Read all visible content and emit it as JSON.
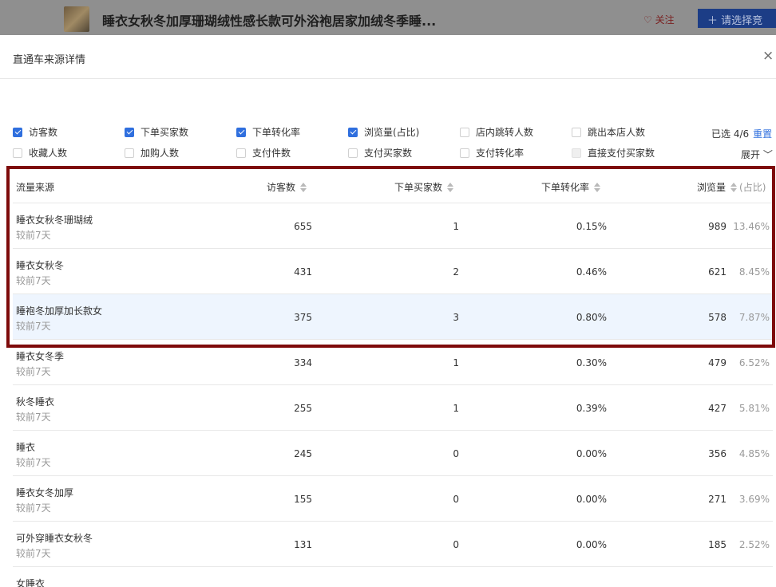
{
  "product": {
    "title": "睡衣女秋冬加厚珊瑚绒性感长款可外浴袍居家加绒冬季睡...",
    "follow_label": "关注",
    "select_button_label": "请选择竞"
  },
  "dialog": {
    "title": "直通车来源详情",
    "close_symbol": "×"
  },
  "filters": {
    "options": [
      {
        "label": "访客数",
        "checked": true
      },
      {
        "label": "下单买家数",
        "checked": true
      },
      {
        "label": "下单转化率",
        "checked": true
      },
      {
        "label": "浏览量(占比)",
        "checked": true
      },
      {
        "label": "店内跳转人数",
        "checked": false
      },
      {
        "label": "跳出本店人数",
        "checked": false
      },
      {
        "label": "收藏人数",
        "checked": false
      },
      {
        "label": "加购人数",
        "checked": false
      },
      {
        "label": "支付件数",
        "checked": false
      },
      {
        "label": "支付买家数",
        "checked": false
      },
      {
        "label": "支付转化率",
        "checked": false
      },
      {
        "label": "直接支付买家数",
        "checked": false,
        "disabled": true
      }
    ],
    "selected_text": "已选 4/6",
    "reset_label": "重置",
    "expand_label": "展开"
  },
  "table": {
    "headers": {
      "source": "流量来源",
      "visitors": "访客数",
      "buyers": "下单买家数",
      "conversion": "下单转化率",
      "views": "浏览量",
      "share": "(占比)"
    },
    "rows": [
      {
        "name": "睡衣女秋冬珊瑚绒",
        "sub": "较前7天",
        "visitors": "655",
        "buyers": "1",
        "conversion": "0.15%",
        "views": "989",
        "share": "13.46%"
      },
      {
        "name": "睡衣女秋冬",
        "sub": "较前7天",
        "visitors": "431",
        "buyers": "2",
        "conversion": "0.46%",
        "views": "621",
        "share": "8.45%"
      },
      {
        "name": "睡袍冬加厚加长款女",
        "sub": "较前7天",
        "visitors": "375",
        "buyers": "3",
        "conversion": "0.80%",
        "views": "578",
        "share": "7.87%"
      },
      {
        "name": "睡衣女冬季",
        "sub": "较前7天",
        "visitors": "334",
        "buyers": "1",
        "conversion": "0.30%",
        "views": "479",
        "share": "6.52%"
      },
      {
        "name": "秋冬睡衣",
        "sub": "较前7天",
        "visitors": "255",
        "buyers": "1",
        "conversion": "0.39%",
        "views": "427",
        "share": "5.81%"
      },
      {
        "name": "睡衣",
        "sub": "较前7天",
        "visitors": "245",
        "buyers": "0",
        "conversion": "0.00%",
        "views": "356",
        "share": "4.85%"
      },
      {
        "name": "睡衣女冬加厚",
        "sub": "较前7天",
        "visitors": "155",
        "buyers": "0",
        "conversion": "0.00%",
        "views": "271",
        "share": "3.69%"
      },
      {
        "name": "可外穿睡衣女秋冬",
        "sub": "较前7天",
        "visitors": "131",
        "buyers": "0",
        "conversion": "0.00%",
        "views": "185",
        "share": "2.52%"
      },
      {
        "name": "女睡衣",
        "sub": "",
        "visitors": "",
        "buyers": "",
        "conversion": "",
        "views": "",
        "share": ""
      }
    ]
  },
  "colors": {
    "accent": "#2f6fde",
    "highlight_box": "#7e0a0a",
    "highlight_row": "#eef5fe"
  }
}
